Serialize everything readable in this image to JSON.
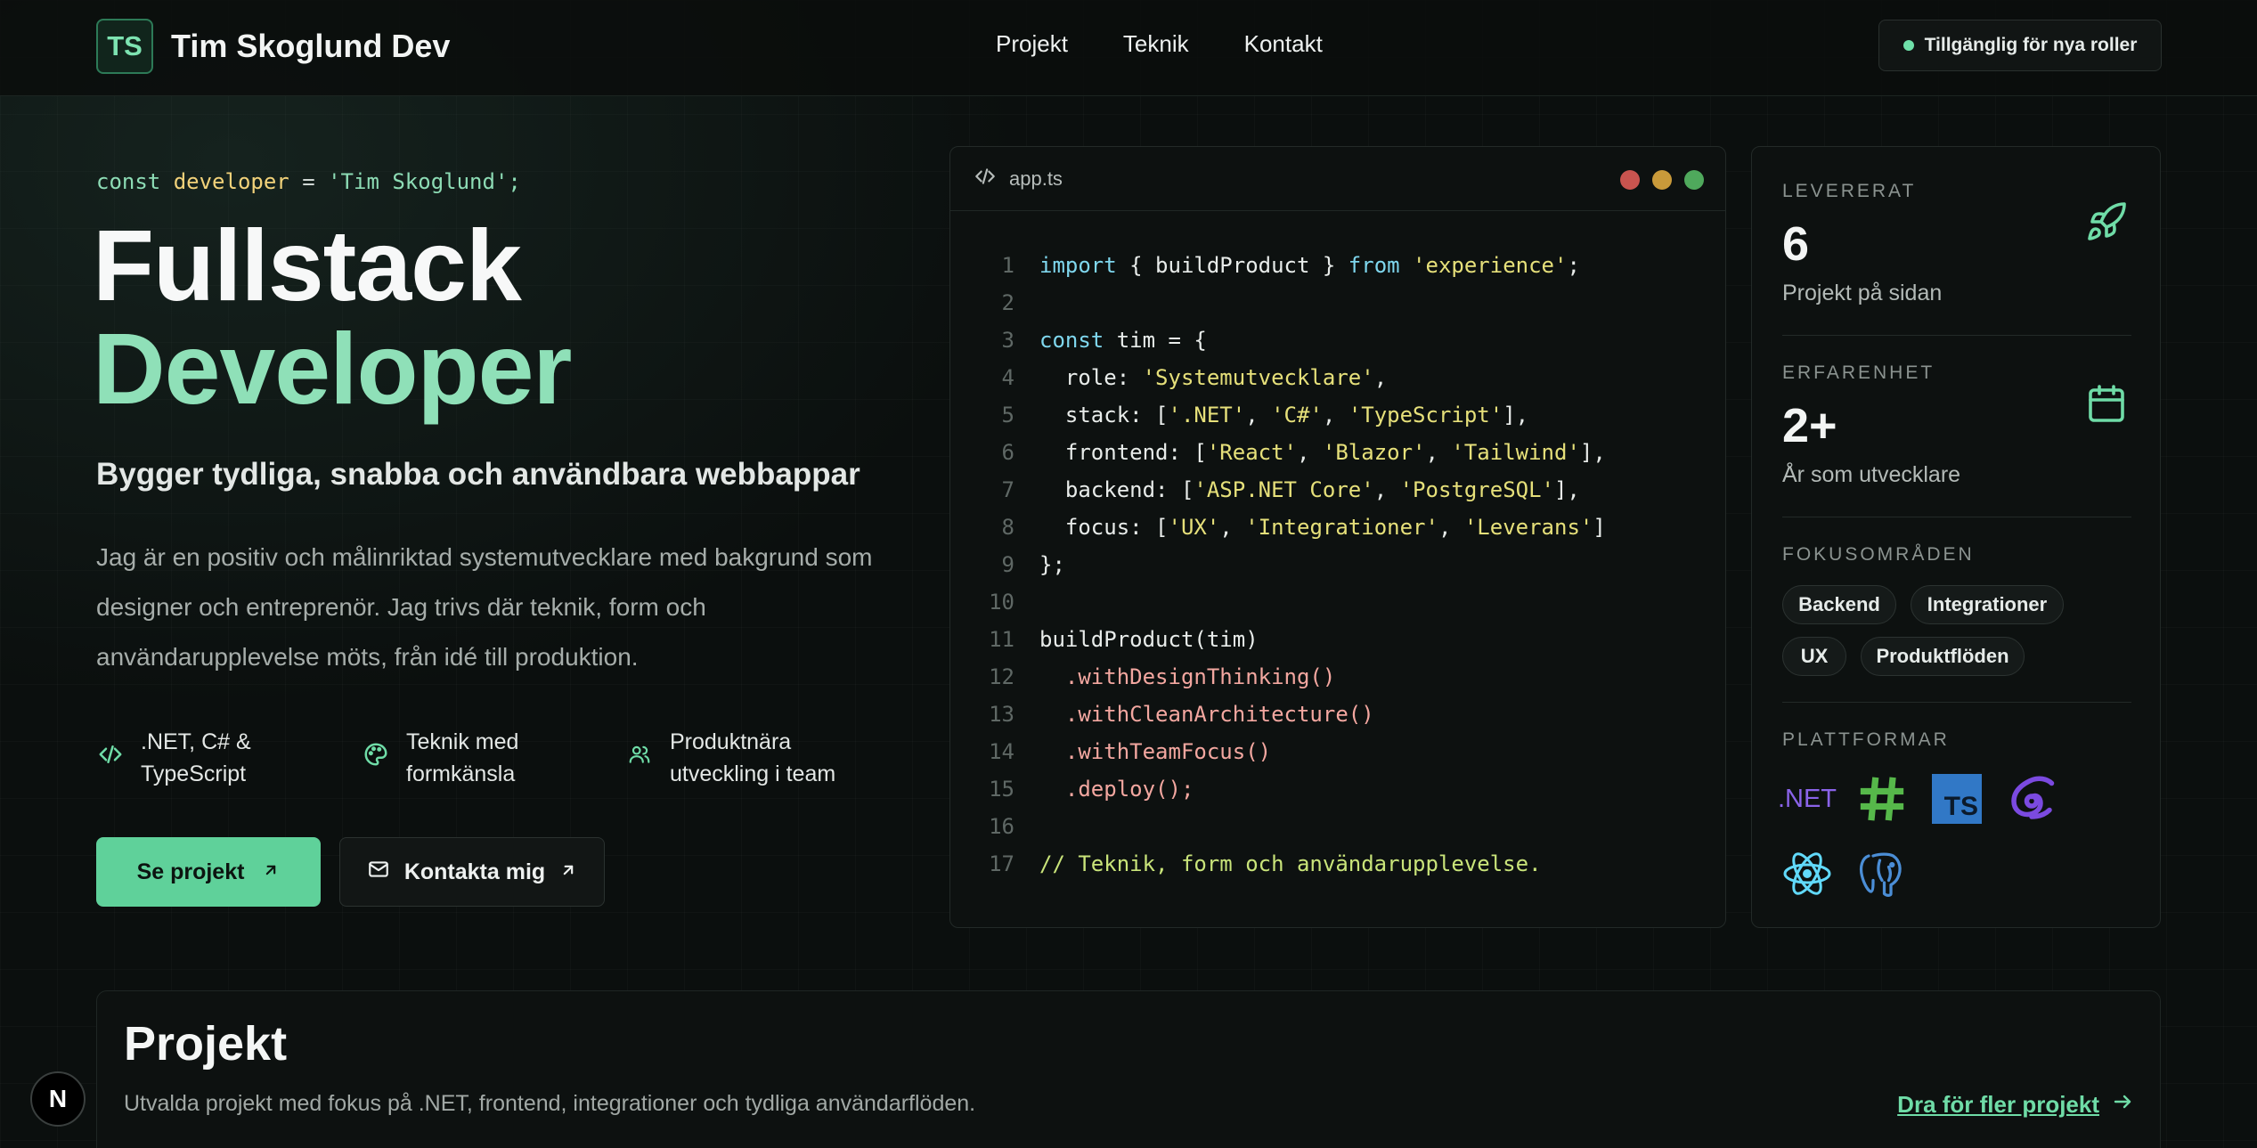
{
  "header": {
    "logo": "TS",
    "brand": "Tim Skoglund Dev",
    "nav": [
      "Projekt",
      "Teknik",
      "Kontakt"
    ],
    "status": "Tillgänglig för nya roller"
  },
  "hero": {
    "code_kw": "const",
    "code_var": "developer",
    "code_op": "=",
    "code_str": "'Tim Skoglund';",
    "title_line1": "Fullstack",
    "title_line2": "Developer",
    "subtitle": "Bygger tydliga, snabba och användbara webbappar",
    "intro": "Jag är en positiv och målinriktad systemutvecklare med bakgrund som designer och entreprenör. Jag trivs där teknik, form och användarupplevelse möts, från idé till produktion.",
    "features": [
      {
        "line1": ".NET, C# &",
        "line2": "TypeScript",
        "icon": "code-icon"
      },
      {
        "line1": "Teknik med",
        "line2": "formkänsla",
        "icon": "palette-icon"
      },
      {
        "line1": "Produktnära",
        "line2": "utveckling i team",
        "icon": "users-icon"
      }
    ],
    "primary_button": "Se projekt",
    "secondary_button": "Kontakta mig"
  },
  "code_panel": {
    "filename": "app.ts",
    "dot_colors": [
      "#e0605a",
      "#e8b64a",
      "#5cc36a"
    ],
    "lines": [
      {
        "n": "1"
      },
      {
        "n": "2"
      },
      {
        "n": "3"
      },
      {
        "n": "4"
      },
      {
        "n": "5"
      },
      {
        "n": "6"
      },
      {
        "n": "7"
      },
      {
        "n": "8"
      },
      {
        "n": "9"
      },
      {
        "n": "10"
      },
      {
        "n": "11"
      },
      {
        "n": "12"
      },
      {
        "n": "13"
      },
      {
        "n": "14"
      },
      {
        "n": "15"
      },
      {
        "n": "16"
      },
      {
        "n": "17"
      }
    ],
    "l1": {
      "a": "import",
      "b": " { buildProduct } ",
      "c": "from",
      "d": " 'experience'",
      "e": ";"
    },
    "l3": {
      "a": "const",
      "b": " tim = {"
    },
    "l4": {
      "a": "  role: ",
      "b": "'Systemutvecklare'",
      "c": ","
    },
    "l5": {
      "a": "  stack: [",
      "b": "'.NET'",
      "c": ", ",
      "d": "'C#'",
      "e": ", ",
      "f": "'TypeScript'",
      "g": "],"
    },
    "l6": {
      "a": "  frontend: [",
      "b": "'React'",
      "c": ", ",
      "d": "'Blazor'",
      "e": ", ",
      "f": "'Tailwind'",
      "g": "],"
    },
    "l7": {
      "a": "  backend: [",
      "b": "'ASP.NET Core'",
      "c": ", ",
      "d": "'PostgreSQL'",
      "e": "],"
    },
    "l8": {
      "a": "  focus: [",
      "b": "'UX'",
      "c": ", ",
      "d": "'Integrationer'",
      "e": ", ",
      "f": "'Leverans'",
      "g": "]"
    },
    "l9": "};",
    "l11": "buildProduct(tim)",
    "l12": "  .withDesignThinking()",
    "l13": "  .withCleanArchitecture()",
    "l14": "  .withTeamFocus()",
    "l15": "  .deploy();",
    "l17": "// Teknik, form och användarupplevelse."
  },
  "stats": {
    "delivered_label": "LEVERERAT",
    "delivered_value": "6",
    "delivered_sub": "Projekt på sidan",
    "experience_label": "ERFARENHET",
    "experience_value": "2+",
    "experience_sub": "År som utvecklare",
    "focus_label": "FOKUSOMRÅDEN",
    "focus_tags": [
      "Backend",
      "Integrationer",
      "UX",
      "Produktflöden"
    ],
    "platforms_label": "PLATTFORMAR",
    "platform_net": ".NET",
    "platform_ts": "TS"
  },
  "projects": {
    "title": "Projekt",
    "description": "Utvalda projekt med fokus på .NET, frontend, integrationer och tydliga användarflöden.",
    "more_link": "Dra för fler projekt"
  },
  "badge": "N",
  "colors": {
    "accent": "#5fd19a",
    "accent_text": "#8fe0b8",
    "background": "#0b0f0e"
  }
}
